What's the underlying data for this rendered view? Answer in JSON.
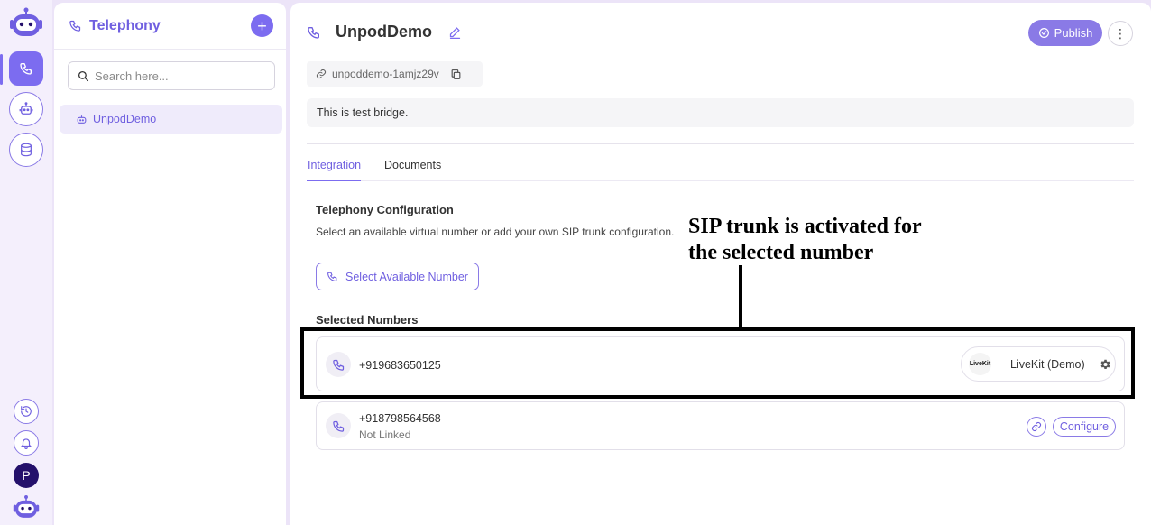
{
  "rail": {
    "logo_icon": "robot-logo-icon",
    "items": [
      {
        "icon": "phone-icon",
        "active": true
      },
      {
        "icon": "robot-icon",
        "active": false
      },
      {
        "icon": "database-icon",
        "active": false
      }
    ],
    "bottom": {
      "history_icon": "history-icon",
      "bell_icon": "bell-icon",
      "avatar_letter": "P"
    }
  },
  "sidebar": {
    "title": "Telephony",
    "add_icon": "plus-icon",
    "search_placeholder": "Search here...",
    "items": [
      {
        "label": "UnpodDemo",
        "icon": "robot-icon"
      }
    ]
  },
  "main": {
    "title": "UnpodDemo",
    "publish_label": "Publish",
    "slug": "unpoddemo-1amjz29v",
    "description": "This is test bridge.",
    "tabs": [
      {
        "label": "Integration",
        "active": true
      },
      {
        "label": "Documents",
        "active": false
      }
    ],
    "telephony": {
      "title": "Telephony Configuration",
      "description": "Select an available virtual number or add your own SIP trunk configuration.",
      "select_button": "Select Available Number"
    },
    "selected_title": "Selected Numbers",
    "numbers": [
      {
        "number": "+919683650125",
        "provider_logo": "LiveKit",
        "provider": "LiveKit (Demo)"
      },
      {
        "number": "+918798564568",
        "status": "Not Linked",
        "configure_label": "Configure"
      }
    ]
  },
  "annotation": {
    "text": "SIP trunk is activated for\nthe selected number"
  },
  "colors": {
    "accent": "#7c6cf0",
    "accent_dark": "#6f5fe0",
    "background": "#ece4f8",
    "avatar": "#24106b"
  }
}
